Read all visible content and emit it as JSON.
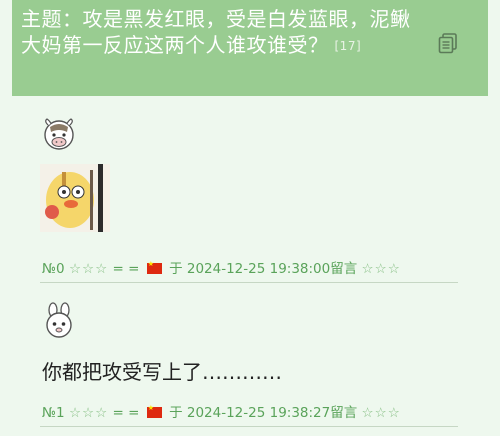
{
  "topic": {
    "title": "主题：攻是黑发红眼，受是白发蓝眼，泥鳅大妈第一反应这两个人谁攻谁受？",
    "reply_count": "[17]",
    "copy_icon": "copy-icon"
  },
  "posts": [
    {
      "avatar_icon": "cow-avatar-icon",
      "content": "",
      "sticker_icon": "sticker-image",
      "number": "№0",
      "stars_left": "☆☆☆",
      "eq": "= =",
      "flag_icon": "china-flag-icon",
      "at": "于",
      "datetime": "2024-12-25 19:38:00留言",
      "stars_right": "☆☆☆"
    },
    {
      "avatar_icon": "rabbit-avatar-icon",
      "content": "你都把攻受写上了…………",
      "number": "№1",
      "stars_left": "☆☆☆",
      "eq": "= =",
      "flag_icon": "china-flag-icon",
      "at": "于",
      "datetime": "2024-12-25 19:38:27留言",
      "stars_right": "☆☆☆"
    }
  ],
  "colors": {
    "header_bg": "#99cc91",
    "page_bg": "#eef8ee",
    "meta_text": "#5aa35a"
  }
}
